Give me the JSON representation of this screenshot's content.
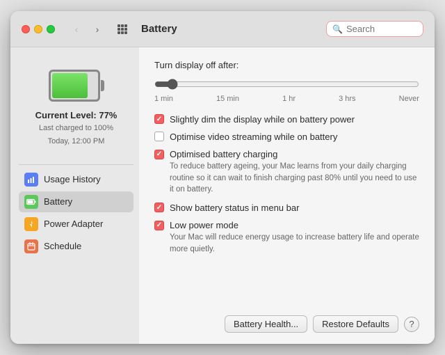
{
  "window": {
    "title": "Battery"
  },
  "titlebar": {
    "back_disabled": true,
    "forward_disabled": false,
    "search_placeholder": "Search"
  },
  "sidebar": {
    "battery_level": "Current Level: 77%",
    "battery_charged": "Last charged to 100%",
    "battery_time": "Today, 12:00 PM",
    "items": [
      {
        "id": "usage-history",
        "label": "Usage History",
        "icon": "📊",
        "icon_type": "usage",
        "active": false
      },
      {
        "id": "battery",
        "label": "Battery",
        "icon": "🔋",
        "icon_type": "battery",
        "active": true
      },
      {
        "id": "power-adapter",
        "label": "Power Adapter",
        "icon": "⚡",
        "icon_type": "power",
        "active": false
      },
      {
        "id": "schedule",
        "label": "Schedule",
        "icon": "📅",
        "icon_type": "schedule",
        "active": false
      }
    ]
  },
  "main": {
    "slider_label": "Turn display off after:",
    "slider_marks": [
      "1 min",
      "15 min",
      "1 hr",
      "3 hrs",
      "Never"
    ],
    "options": [
      {
        "id": "dim-display",
        "label": "Slightly dim the display while on battery power",
        "checked": true,
        "desc": ""
      },
      {
        "id": "video-streaming",
        "label": "Optimise video streaming while on battery",
        "checked": false,
        "desc": ""
      },
      {
        "id": "optimised-charging",
        "label": "Optimised battery charging",
        "checked": true,
        "desc": "To reduce battery ageing, your Mac learns from your daily charging routine so it can wait to finish charging past 80% until you need to use it on battery."
      },
      {
        "id": "menu-bar",
        "label": "Show battery status in menu bar",
        "checked": true,
        "desc": ""
      },
      {
        "id": "low-power",
        "label": "Low power mode",
        "checked": true,
        "desc": "Your Mac will reduce energy usage to increase battery life and operate more quietly."
      }
    ],
    "buttons": {
      "battery_health": "Battery Health...",
      "restore_defaults": "Restore Defaults",
      "help": "?"
    }
  }
}
